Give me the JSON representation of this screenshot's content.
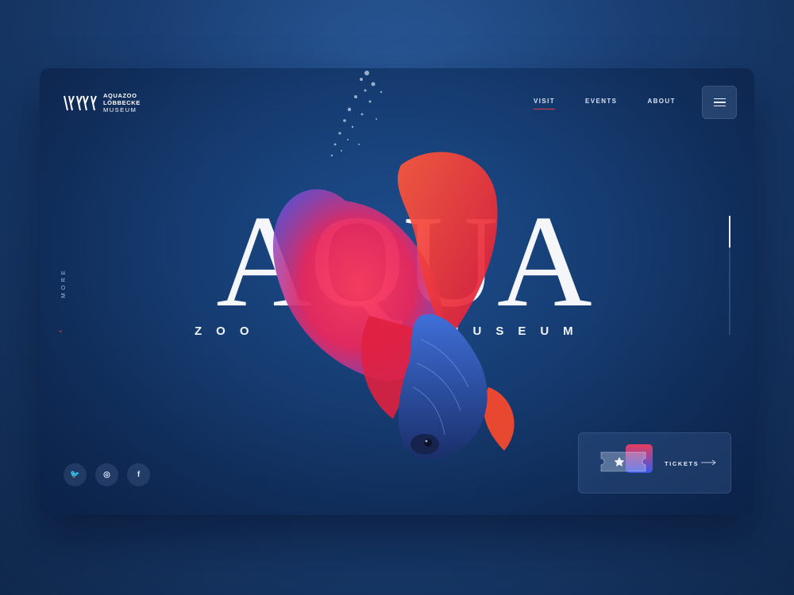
{
  "logo": {
    "line1": "AQUAZOO",
    "line2": "LÖBBECKE",
    "line3": "MUSEUM"
  },
  "nav": {
    "items": [
      {
        "label": "VISIT",
        "active": true
      },
      {
        "label": "EVENTS",
        "active": false
      },
      {
        "label": "ABOUT",
        "active": false
      }
    ]
  },
  "menu": {
    "icon": "hamburger-icon"
  },
  "side": {
    "more_label": "MORE",
    "more_icon": "chevron-down-icon"
  },
  "hero": {
    "title": "AQUA",
    "subtitle_left": "ZOO",
    "subtitle_right": "MUSEUM",
    "image": "betta-fish"
  },
  "socials": [
    {
      "name": "twitter-icon",
      "glyph": "🐦"
    },
    {
      "name": "instagram-icon",
      "glyph": "◎"
    },
    {
      "name": "facebook-icon",
      "glyph": "f"
    }
  ],
  "tickets": {
    "label": "TICKETS",
    "icon": "ticket-star-icon",
    "arrow": "arrow-right-icon"
  },
  "colors": {
    "accent": "#e8344a",
    "background": "#163d73",
    "text": "#f4f6fa"
  }
}
